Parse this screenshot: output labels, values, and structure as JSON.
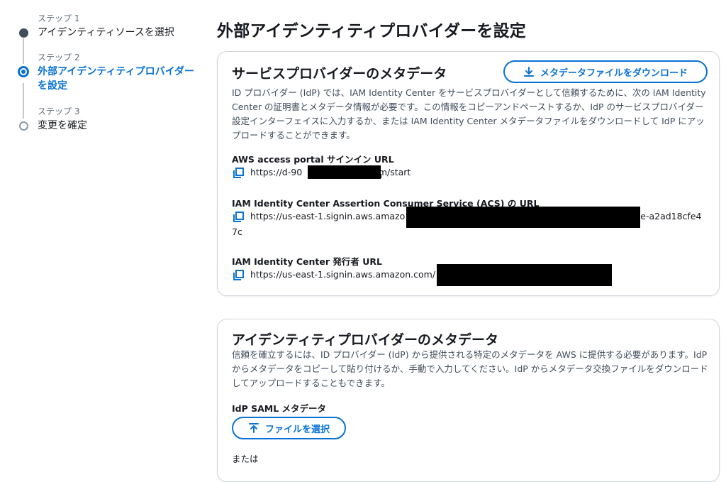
{
  "wizard": {
    "steps": [
      {
        "label": "ステップ 1",
        "title": "アイデンティティソースを選択",
        "state": "done"
      },
      {
        "label": "ステップ 2",
        "title_line1": "外部アイデンティティプロバイダー",
        "title_line2": "を設定",
        "state": "current"
      },
      {
        "label": "ステップ 3",
        "title": "変更を確定",
        "state": "future"
      }
    ]
  },
  "page": {
    "title": "外部アイデンティティプロバイダーを設定"
  },
  "sp_metadata": {
    "title": "サービスプロバイダーのメタデータ",
    "download_button": "メタデータファイルをダウンロード",
    "description": "ID プロバイダー (IdP) では、IAM Identity Center をサービスプロバイダーとして信頼するために、次の IAM Identity Center の証明書とメタデータ情報が必要です。この情報をコピーアンドペーストするか、IdP のサービスプロバイダー設定インターフェイスに入力するか、または IAM Identity Center メタデータファイルをダウンロードして IdP にアップロードすることができます。",
    "portal_label": "AWS access portal サインイン URL",
    "portal_url_start": "https://d-90",
    "portal_url_end": "om/start",
    "acs_label": "IAM Identity Center Assertion Consumer Service (ACS) の URL",
    "acs_url_start": "https://us-east-1.signin.aws.amazo",
    "acs_url_end": "e-a2ad18cfe4",
    "acs_url_wrap": "7c",
    "issuer_label": "IAM Identity Center 発行者 URL",
    "issuer_url_start": "https://us-east-1.signin.aws.amazon.com/"
  },
  "idp_metadata": {
    "title": "アイデンティティプロバイダーのメタデータ",
    "description": "信頼を確立するには、ID プロバイダー (IdP) から提供される特定のメタデータを AWS に提供する必要があります。IdP からメタデータをコピーして貼り付けるか、手動で入力してください。IdP からメタデータ交換ファイルをダウンロードしてアップロードすることもできます。",
    "saml_label": "IdP SAML メタデータ",
    "choose_file_button": "ファイルを選択",
    "or_text": "または"
  },
  "icons": {
    "download": "download-icon",
    "copy": "copy-icon",
    "upload": "upload-icon"
  },
  "colors": {
    "accent": "#0972d3",
    "text": "#16191f",
    "secondary_text": "#414d5c",
    "border": "#d1d5db"
  }
}
